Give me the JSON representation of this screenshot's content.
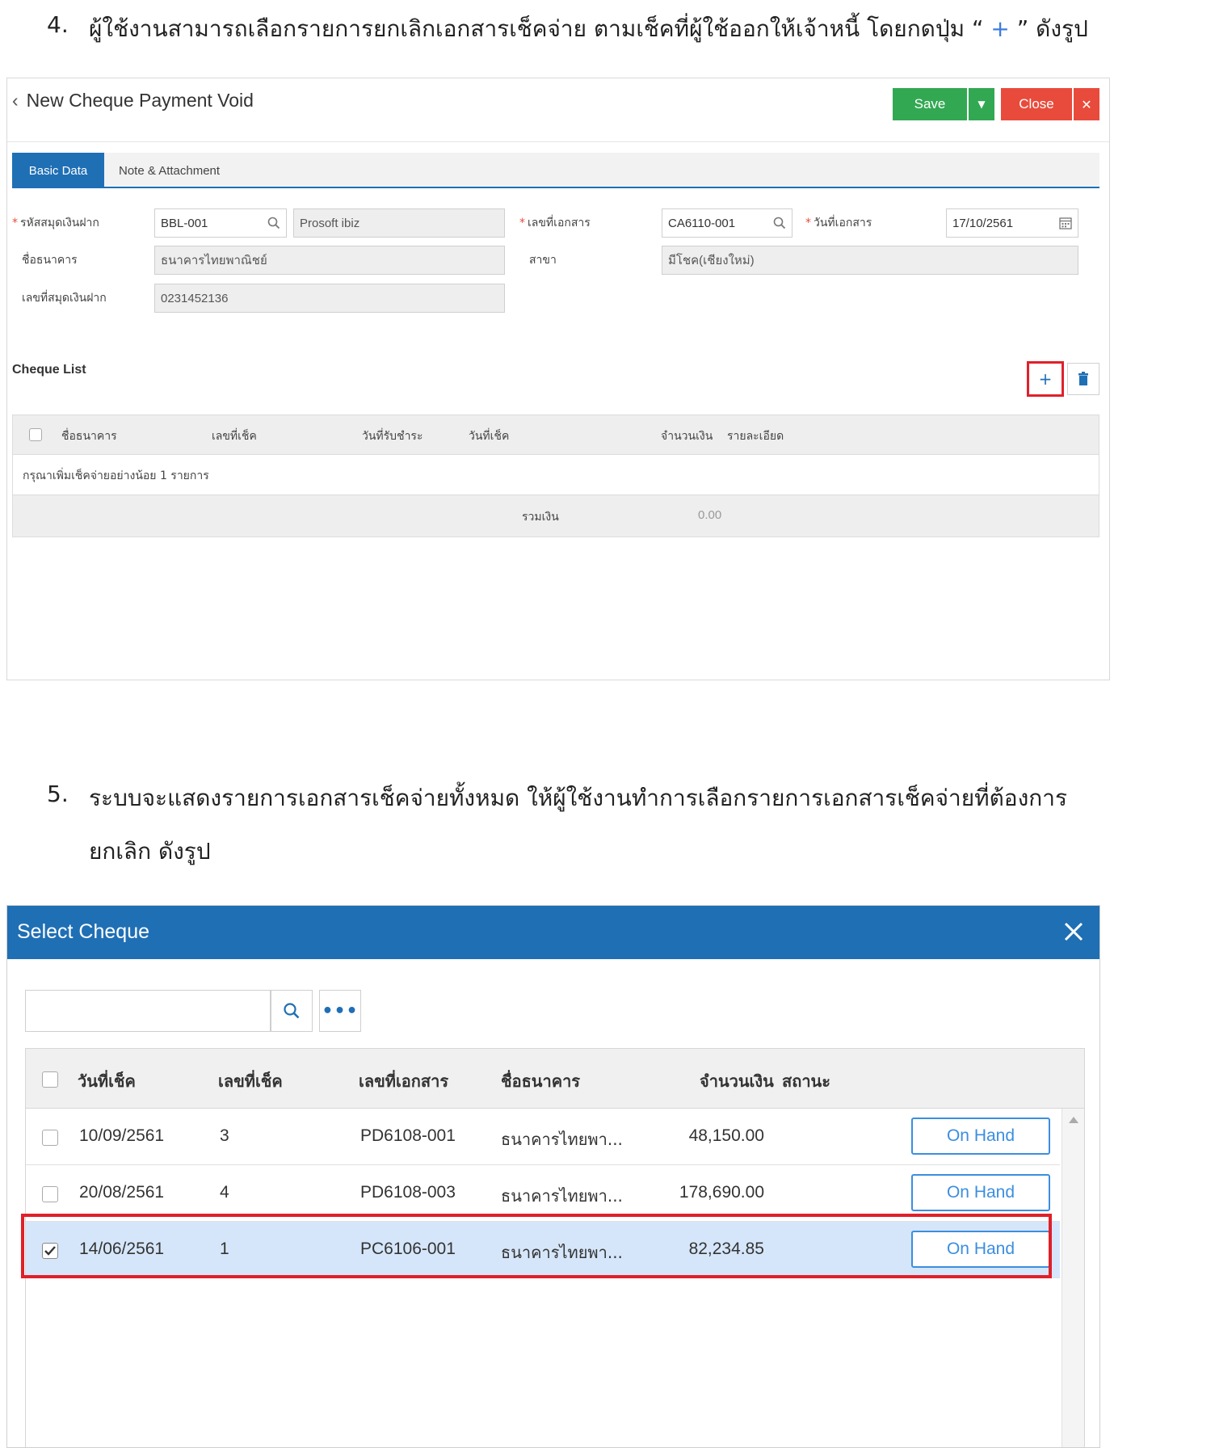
{
  "instructions": {
    "step4_num": "4.",
    "step4_text_a": "ผู้ใช้งานสามารถเลือกรายการยกเลิกเอกสารเช็คจ่าย ตามเช็คที่ผู้ใช้ออกให้เจ้าหนี้ โดยกดปุ่ม “",
    "step4_plus": "+",
    "step4_text_b": "” ดังรูป",
    "step5_num": "5.",
    "step5_line1": "ระบบจะแสดงรายการเอกสารเช็คจ่ายทั้งหมด ให้ผู้ใช้งานทำการเลือกรายการเอกสารเช็คจ่ายที่ต้องการ",
    "step5_line2": "ยกเลิก ดังรูป"
  },
  "form": {
    "back_icon": "chevron-left-icon",
    "title": "New Cheque Payment Void",
    "save_label": "Save",
    "close_label": "Close",
    "tabs": [
      {
        "label": "Basic Data",
        "active": true
      },
      {
        "label": "Note & Attachment",
        "active": false
      }
    ],
    "fields": {
      "passbook_code_label": "รหัสสมุดเงินฝาก",
      "passbook_code_value": "BBL-001",
      "passbook_name_value": "Prosoft ibiz",
      "doc_no_label": "เลขที่เอกสาร",
      "doc_no_value": "CA6110-001",
      "doc_date_label": "วันที่เอกสาร",
      "doc_date_value": "17/10/2561",
      "bank_name_label": "ชื่อธนาคาร",
      "bank_name_value": "ธนาคารไทยพาณิชย์",
      "branch_label": "สาขา",
      "branch_value": "มีโชค(เชียงใหม่)",
      "passbook_no_label": "เลขที่สมุดเงินฝาก",
      "passbook_no_value": "0231452136"
    },
    "cheque_list": {
      "title": "Cheque List",
      "add_label": "+",
      "headers": [
        "ชื่อธนาคาร",
        "เลขที่เช็ค",
        "วันที่รับชำระ",
        "วันที่เช็ค",
        "จำนวนเงิน",
        "รายละเอียด"
      ],
      "empty_message": "กรุณาเพิ่มเช็คจ่ายอย่างน้อย 1 รายการ",
      "total_label": "รวมเงิน",
      "total_value": "0.00"
    }
  },
  "dialog": {
    "title": "Select Cheque",
    "close_icon": "close-icon",
    "search_placeholder": "",
    "more_label": "•••",
    "headers": [
      "วันที่เช็ค",
      "เลขที่เช็ค",
      "เลขที่เอกสาร",
      "ชื่อธนาคาร",
      "จำนวนเงิน",
      "สถานะ"
    ],
    "rows": [
      {
        "date": "10/09/2561",
        "cheque_no": "3",
        "doc_no": "PD6108-001",
        "bank": "ธนาคารไทยพา...",
        "amount": "48,150.00",
        "status": "On Hand",
        "checked": false
      },
      {
        "date": "20/08/2561",
        "cheque_no": "4",
        "doc_no": "PD6108-003",
        "bank": "ธนาคารไทยพา...",
        "amount": "178,690.00",
        "status": "On Hand",
        "checked": false
      },
      {
        "date": "14/06/2561",
        "cheque_no": "1",
        "doc_no": "PC6106-001",
        "bank": "ธนาคารไทยพา...",
        "amount": "82,234.85",
        "status": "On Hand",
        "checked": true
      }
    ]
  },
  "colors": {
    "primary": "#1f6fb5",
    "save": "#32a852",
    "close": "#e84b3c",
    "highlight": "#e0202a",
    "selected_row": "#d6e6fa"
  }
}
